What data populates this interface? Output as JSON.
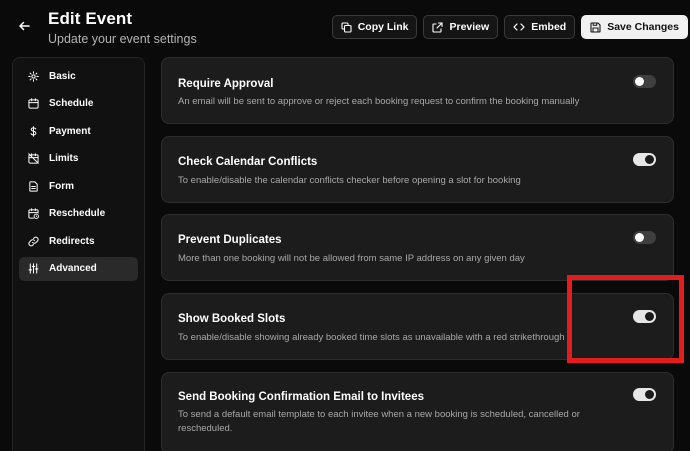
{
  "header": {
    "title": "Edit Event",
    "subtitle": "Update your event settings"
  },
  "toolbar": {
    "copy_link": "Copy Link",
    "preview": "Preview",
    "embed": "Embed",
    "save": "Save Changes"
  },
  "sidebar": {
    "items": [
      {
        "label": "Basic",
        "icon": "gear-icon"
      },
      {
        "label": "Schedule",
        "icon": "calendar-icon"
      },
      {
        "label": "Payment",
        "icon": "dollar-icon"
      },
      {
        "label": "Limits",
        "icon": "calendar-off-icon"
      },
      {
        "label": "Form",
        "icon": "document-icon"
      },
      {
        "label": "Reschedule",
        "icon": "calendar-clock-icon"
      },
      {
        "label": "Redirects",
        "icon": "link-icon"
      },
      {
        "label": "Advanced",
        "icon": "sliders-icon",
        "active": true
      }
    ]
  },
  "settings": [
    {
      "title": "Require Approval",
      "description": "An email will be sent to approve or reject each booking request to confirm the booking manually",
      "enabled": false
    },
    {
      "title": "Check Calendar Conflicts",
      "description": "To enable/disable the calendar conflicts checker before opening a slot for booking",
      "enabled": true
    },
    {
      "title": "Prevent Duplicates",
      "description": "More than one booking will not be allowed from same IP address on any given day",
      "enabled": false
    },
    {
      "title": "Show Booked Slots",
      "description": "To enable/disable showing already booked time slots as unavailable with a red strikethrough",
      "enabled": true
    },
    {
      "title": "Send Booking Confirmation Email to Invitees",
      "description": "To send a default email template to each invitee when a new booking is scheduled, cancelled or rescheduled.",
      "enabled": true
    }
  ],
  "colors": {
    "background": "#0a0a0a",
    "card": "#1c1c1c",
    "highlight": "#e41c1c"
  }
}
